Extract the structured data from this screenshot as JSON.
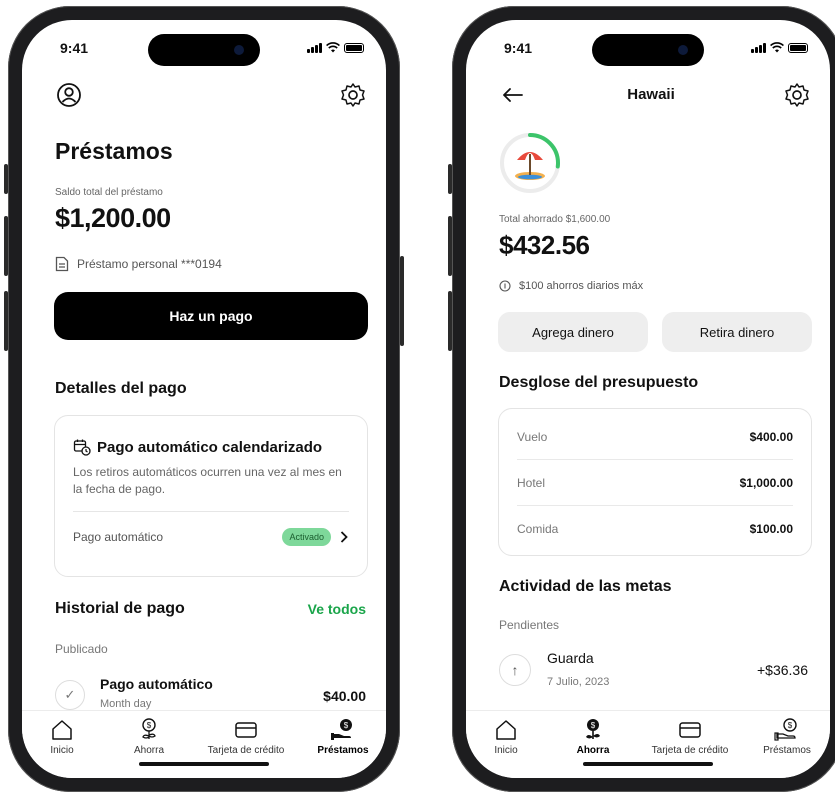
{
  "left_phone": {
    "status": {
      "time": "9:41"
    },
    "title": "Préstamos",
    "balance_label": "Saldo total del préstamo",
    "balance_amount": "$1,200.00",
    "loan_name": "Préstamo personal ***0194",
    "pay_button": "Haz un pago",
    "details_heading": "Detalles del pago",
    "autopay": {
      "title": "Pago automático calendarizado",
      "description": "Los retiros automáticos ocurren una vez al mes en la fecha de pago.",
      "row_label": "Pago automático",
      "badge": "Activado"
    },
    "history_heading": "Historial de pago",
    "history_link": "Ve todos",
    "published_label": "Publicado",
    "history_items": [
      {
        "name": "Pago automático",
        "subtitle": "Month day",
        "amount": "$40.00"
      }
    ],
    "tabs": [
      {
        "label": "Inicio",
        "icon": "home-icon"
      },
      {
        "label": "Ahorra",
        "icon": "savings-plant-icon"
      },
      {
        "label": "Tarjeta de crédito",
        "icon": "credit-card-icon"
      },
      {
        "label": "Préstamos",
        "icon": "loan-hand-icon",
        "active": true
      }
    ]
  },
  "right_phone": {
    "status": {
      "time": "9:41"
    },
    "header_title": "Hawaii",
    "goal_icon": "beach-umbrella-icon",
    "goal_progress": 0.27,
    "total_label": "Total ahorrado $1,600.00",
    "saved_amount": "$432.56",
    "daily_note": "$100 ahorros diarios máx",
    "add_button": "Agrega dinero",
    "withdraw_button": "Retira dinero",
    "budget_heading": "Desglose del presupuesto",
    "budget_items": [
      {
        "name": "Vuelo",
        "amount": "$400.00"
      },
      {
        "name": "Hotel",
        "amount": "$1,000.00"
      },
      {
        "name": "Comida",
        "amount": "$100.00"
      }
    ],
    "activity_heading": "Actividad de las metas",
    "pending_label": "Pendientes",
    "activity_items": [
      {
        "name": "Guarda",
        "date": "7 Julio, 2023",
        "amount": "+$36.36"
      }
    ],
    "tabs": [
      {
        "label": "Inicio",
        "icon": "home-icon"
      },
      {
        "label": "Ahorra",
        "icon": "savings-plant-icon",
        "active": true
      },
      {
        "label": "Tarjeta de crédito",
        "icon": "credit-card-icon"
      },
      {
        "label": "Préstamos",
        "icon": "loan-hand-icon"
      }
    ]
  },
  "colors": {
    "accent_green": "#1aa54a",
    "badge_green": "#7ed89a",
    "primary_black": "#000000",
    "progress_green": "#3cc46a"
  }
}
